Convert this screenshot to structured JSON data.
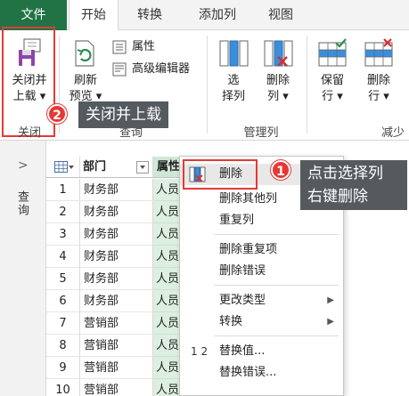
{
  "tabs": {
    "file": "文件",
    "home": "开始",
    "transform": "转换",
    "add_column": "添加列",
    "view": "视图"
  },
  "ribbon": {
    "close_load_line1": "关闭并",
    "close_load_line2": "上载",
    "refresh_line1": "刷新",
    "refresh_line2": "预览",
    "properties": "属性",
    "advanced_editor": "高级编辑器",
    "select_col_line1": "选",
    "select_col_line2": "择列",
    "remove_col_line1": "删除",
    "remove_col_line2": "列",
    "keep_rows_line1": "保留",
    "keep_rows_line2": "行",
    "remove_rows_line1": "删除",
    "remove_rows_line2": "行",
    "group_close": "关闭",
    "group_query": "查询",
    "group_manage_columns": "管理列",
    "group_reduce_rows": "减少"
  },
  "callouts": {
    "step1_num": "1",
    "step1_line1": "点击选择列",
    "step1_line2": "右键删除",
    "step2_num": "2",
    "step2_text": "关闭并上载"
  },
  "nav": {
    "label": "查询",
    "toggle": ">"
  },
  "grid": {
    "col1_header": "部门",
    "col2_header": "属性",
    "rows": [
      {
        "num": "1",
        "dept": "财务部",
        "attr": "人员"
      },
      {
        "num": "2",
        "dept": "财务部",
        "attr": "人员"
      },
      {
        "num": "3",
        "dept": "财务部",
        "attr": "人员"
      },
      {
        "num": "4",
        "dept": "财务部",
        "attr": "人员"
      },
      {
        "num": "5",
        "dept": "财务部",
        "attr": "人员"
      },
      {
        "num": "6",
        "dept": "财务部",
        "attr": "人员"
      },
      {
        "num": "7",
        "dept": "营销部",
        "attr": "人员"
      },
      {
        "num": "8",
        "dept": "营销部",
        "attr": "人员"
      },
      {
        "num": "9",
        "dept": "营销部",
        "attr": "人员"
      },
      {
        "num": "10",
        "dept": "营销部",
        "attr": "人员"
      }
    ]
  },
  "context_menu": {
    "remove": "删除",
    "remove_other": "删除其他列",
    "duplicate": "重复列",
    "remove_duplicates": "删除重复项",
    "remove_errors": "删除错误",
    "change_type": "更改类型",
    "transform": "转换",
    "replace_values": "替换值...",
    "replace_errors": "替换错误...",
    "icon_12": "1 2"
  },
  "colors": {
    "file_tab": "#217346",
    "highlight_red": "#e53935",
    "callout_bg": "#555a5e",
    "selected_column": "#dcefe1"
  }
}
